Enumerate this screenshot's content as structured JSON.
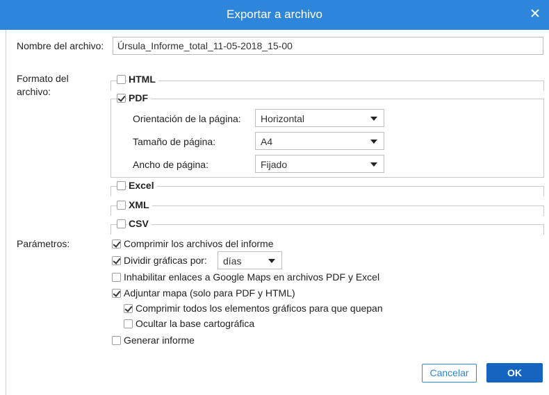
{
  "dialog": {
    "title": "Exportar a archivo",
    "close_label": "×"
  },
  "filename": {
    "label": "Nombre del archivo:",
    "value": "Úrsula_Informe_total_11-05-2018_15-00"
  },
  "format": {
    "label_line1": "Formato del",
    "label_line2": "archivo:",
    "html": {
      "label": "HTML",
      "checked": false
    },
    "pdf": {
      "label": "PDF",
      "checked": true,
      "orientation_label": "Orientación de la página:",
      "orientation_value": "Horizontal",
      "size_label": "Tamaño de página:",
      "size_value": "A4",
      "width_label": "Ancho de página:",
      "width_value": "Fijado"
    },
    "excel": {
      "label": "Excel",
      "checked": false
    },
    "xml": {
      "label": "XML",
      "checked": false
    },
    "csv": {
      "label": "CSV",
      "checked": false
    }
  },
  "params": {
    "label": "Parámetros:",
    "compress": {
      "label": "Comprimir los archivos del informe",
      "checked": true
    },
    "split": {
      "label": "Dividir gráficas por:",
      "checked": true,
      "select_value": "días"
    },
    "disable_links": {
      "label": "Inhabilitar enlaces a Google Maps en archivos PDF y Excel",
      "checked": false
    },
    "attach_map": {
      "label": "Adjuntar mapa (solo para PDF y HTML)",
      "checked": true
    },
    "compress_graphics": {
      "label": "Comprimir todos los elementos gráficos para que quepan",
      "checked": true
    },
    "hide_base": {
      "label": "Ocultar la base cartográfica",
      "checked": false
    },
    "generate": {
      "label": "Generar informe",
      "checked": false
    }
  },
  "buttons": {
    "cancel": "Cancelar",
    "ok": "OK"
  },
  "colors": {
    "titlebar": "#2d86d9",
    "ok_button": "#1565c0"
  }
}
